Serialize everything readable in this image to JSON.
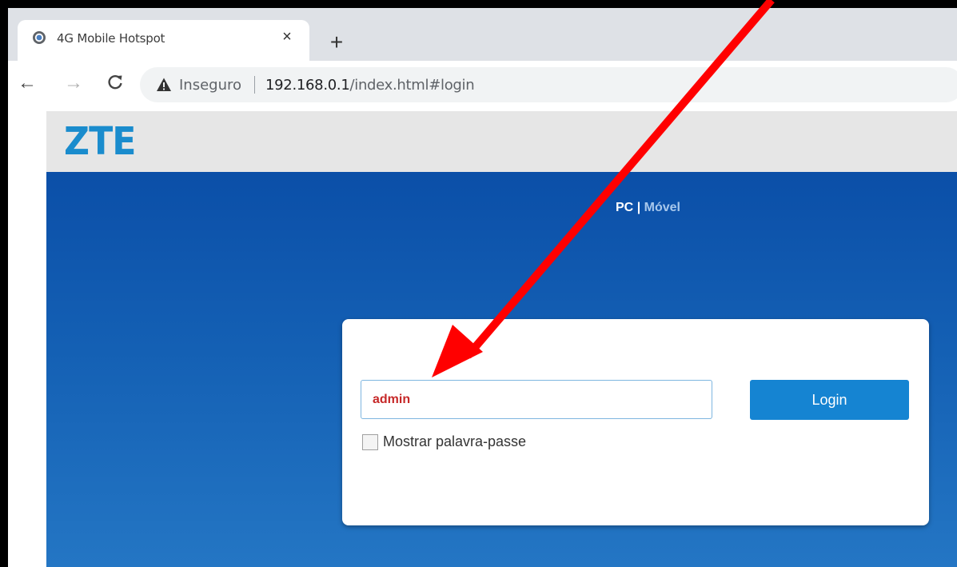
{
  "browser": {
    "tab": {
      "title": "4G Mobile Hotspot",
      "close_glyph": "×",
      "favicon": "globe-icon"
    },
    "new_tab_glyph": "+",
    "nav": {
      "back_glyph": "←",
      "forward_glyph": "→",
      "reload_glyph": "C"
    },
    "omnibox": {
      "security_label": "Inseguro",
      "url_host": "192.168.0.1",
      "url_path": "/index.html#login"
    }
  },
  "page": {
    "logo": "ZTE",
    "view_switch": {
      "pc": "PC",
      "separator": "|",
      "mobile": "Móvel"
    },
    "login": {
      "password_value": "admin",
      "button_label": "Login",
      "show_password_label": "Mostrar palavra-passe",
      "show_password_checked": false
    }
  },
  "colors": {
    "logo": "#1a8ccd",
    "banner_top": "#0b4fa8",
    "banner_bottom": "#2476c4",
    "login_button": "#1584d2",
    "password_text": "#c62828",
    "annotation_arrow": "#ff0000"
  }
}
